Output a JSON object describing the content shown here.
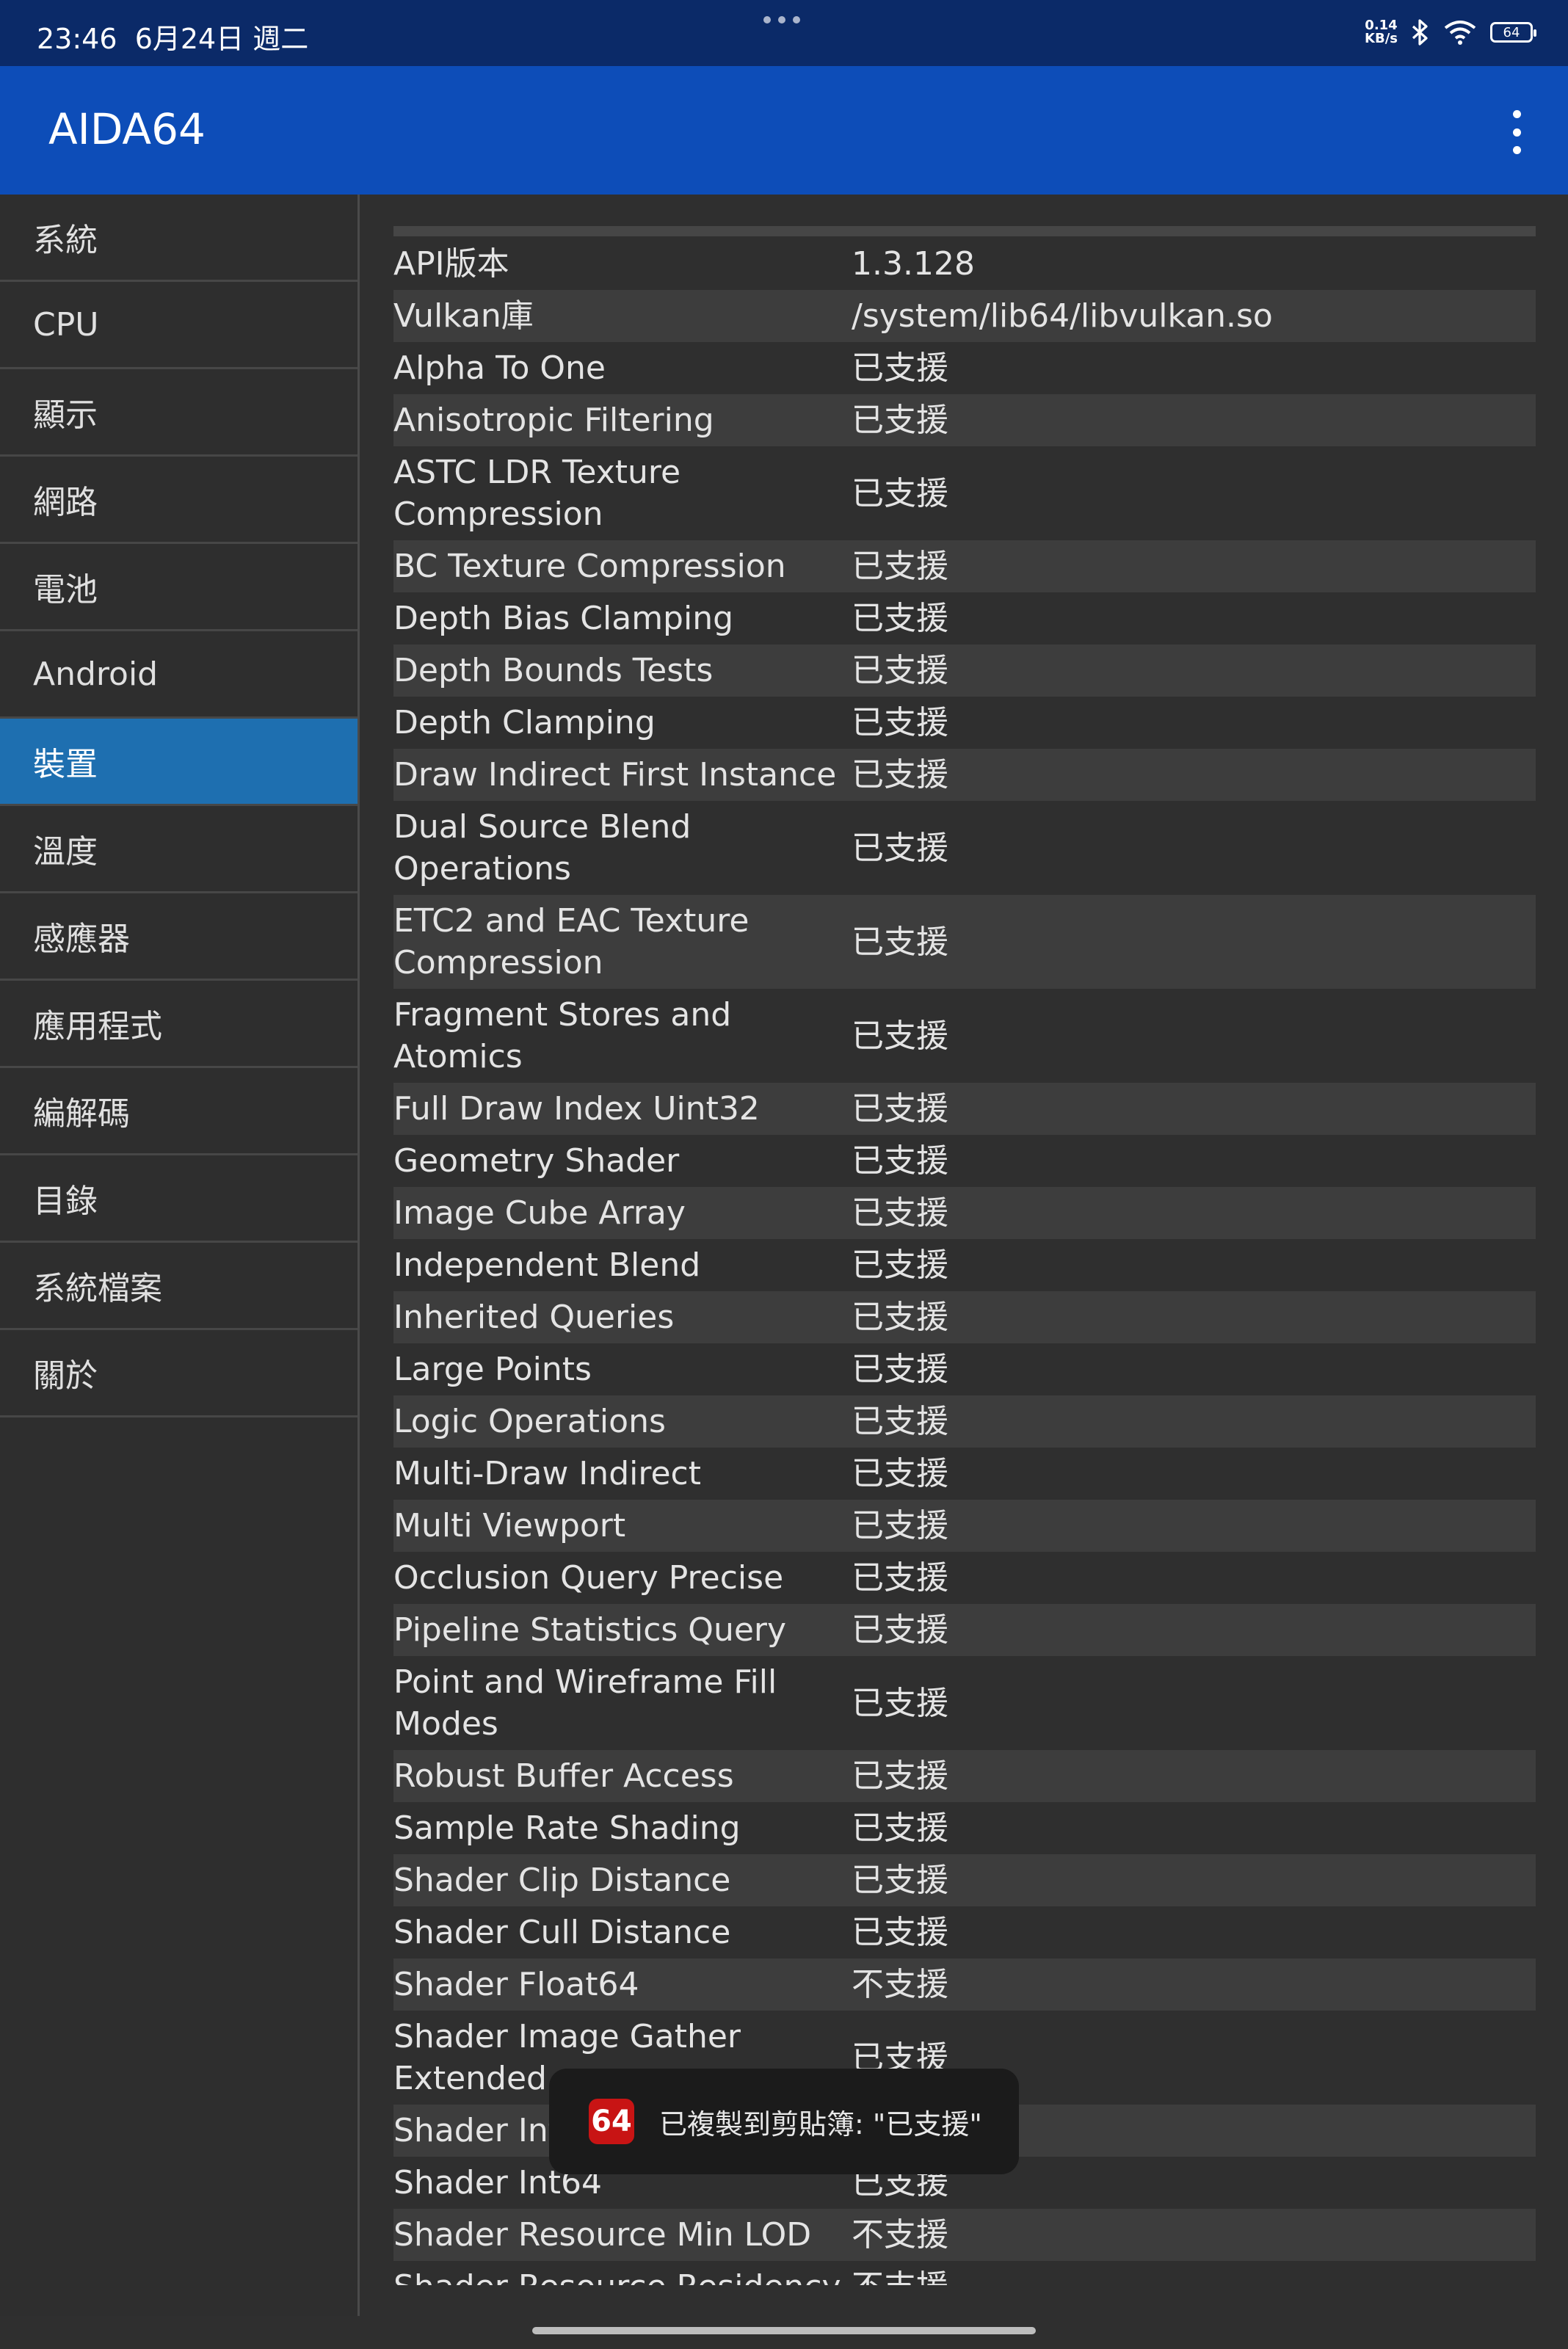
{
  "status_bar": {
    "time": "23:46",
    "date": "6月24日 週二",
    "net_speed_value": "0.14",
    "net_speed_unit": "KB/s",
    "battery": "64",
    "icons": [
      "bluetooth-icon",
      "wifi-icon",
      "battery-icon"
    ]
  },
  "app_bar": {
    "title": "AIDA64",
    "menu_icon": "more-vert-icon"
  },
  "sidebar": {
    "items": [
      {
        "label": "系統"
      },
      {
        "label": "CPU"
      },
      {
        "label": "顯示"
      },
      {
        "label": "網路"
      },
      {
        "label": "電池"
      },
      {
        "label": "Android"
      },
      {
        "label": "裝置"
      },
      {
        "label": "溫度"
      },
      {
        "label": "感應器"
      },
      {
        "label": "應用程式"
      },
      {
        "label": "編解碼"
      },
      {
        "label": "目錄"
      },
      {
        "label": "系統檔案"
      },
      {
        "label": "關於"
      }
    ],
    "active_index": 6,
    "active_color": "#1e6fb0"
  },
  "table": {
    "rows": [
      {
        "key": "API版本",
        "value": "1.3.128"
      },
      {
        "key": "Vulkan庫",
        "value": "/system/lib64/libvulkan.so"
      },
      {
        "key": "Alpha To One",
        "value": "已支援"
      },
      {
        "key": "Anisotropic Filtering",
        "value": "已支援"
      },
      {
        "key": "ASTC LDR Texture Compression",
        "value": "已支援"
      },
      {
        "key": "BC Texture Compression",
        "value": "已支援"
      },
      {
        "key": "Depth Bias Clamping",
        "value": "已支援"
      },
      {
        "key": "Depth Bounds Tests",
        "value": "已支援"
      },
      {
        "key": "Depth Clamping",
        "value": "已支援"
      },
      {
        "key": "Draw Indirect First Instance",
        "value": "已支援"
      },
      {
        "key": "Dual Source Blend Operations",
        "value": "已支援"
      },
      {
        "key": "ETC2 and EAC Texture Compression",
        "value": "已支援"
      },
      {
        "key": "Fragment Stores and Atomics",
        "value": "已支援"
      },
      {
        "key": "Full Draw Index Uint32",
        "value": "已支援"
      },
      {
        "key": "Geometry Shader",
        "value": "已支援"
      },
      {
        "key": "Image Cube Array",
        "value": "已支援"
      },
      {
        "key": "Independent Blend",
        "value": "已支援"
      },
      {
        "key": "Inherited Queries",
        "value": "已支援"
      },
      {
        "key": "Large Points",
        "value": "已支援"
      },
      {
        "key": "Logic Operations",
        "value": "已支援"
      },
      {
        "key": "Multi-Draw Indirect",
        "value": "已支援"
      },
      {
        "key": "Multi Viewport",
        "value": "已支援"
      },
      {
        "key": "Occlusion Query Precise",
        "value": "已支援"
      },
      {
        "key": "Pipeline Statistics Query",
        "value": "已支援"
      },
      {
        "key": "Point and Wireframe Fill Modes",
        "value": "已支援"
      },
      {
        "key": "Robust Buffer Access",
        "value": "已支援"
      },
      {
        "key": "Sample Rate Shading",
        "value": "已支援"
      },
      {
        "key": "Shader Clip Distance",
        "value": "已支援"
      },
      {
        "key": "Shader Cull Distance",
        "value": "已支援"
      },
      {
        "key": "Shader Float64",
        "value": "不支援"
      },
      {
        "key": "Shader Image Gather Extended",
        "value": "已支援"
      },
      {
        "key": "Shader Int16",
        "value": "已支援"
      },
      {
        "key": "Shader Int64",
        "value": "已支援"
      },
      {
        "key": "Shader Resource Min LOD",
        "value": "不支援"
      },
      {
        "key": "Shader Resource Residency",
        "value": "不支援"
      }
    ]
  },
  "toast": {
    "icon_label": "64",
    "text": "已複製到剪貼簿: \"已支援\""
  }
}
